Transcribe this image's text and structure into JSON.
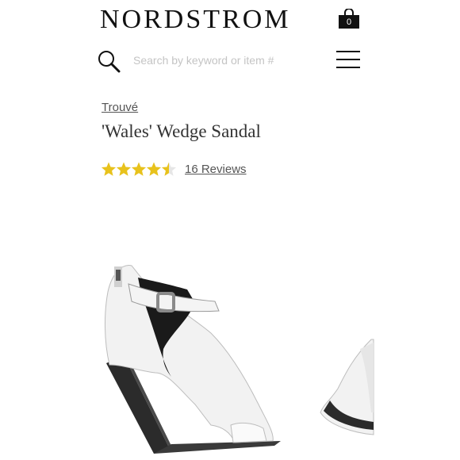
{
  "header": {
    "logo": "NORDSTROM",
    "cart_count": "0"
  },
  "search": {
    "placeholder": "Search by keyword or item #"
  },
  "product": {
    "brand": "Trouvé",
    "title": "'Wales' Wedge Sandal",
    "rating": 4.5,
    "rating_max": 5,
    "reviews_label": "16 Reviews"
  },
  "colors": {
    "star_filled": "#e8c21c",
    "star_empty": "#e6e6e6",
    "text_dark": "#111111"
  },
  "icons": [
    "shopping-bag-icon",
    "search-icon",
    "menu-icon",
    "star-icon"
  ]
}
